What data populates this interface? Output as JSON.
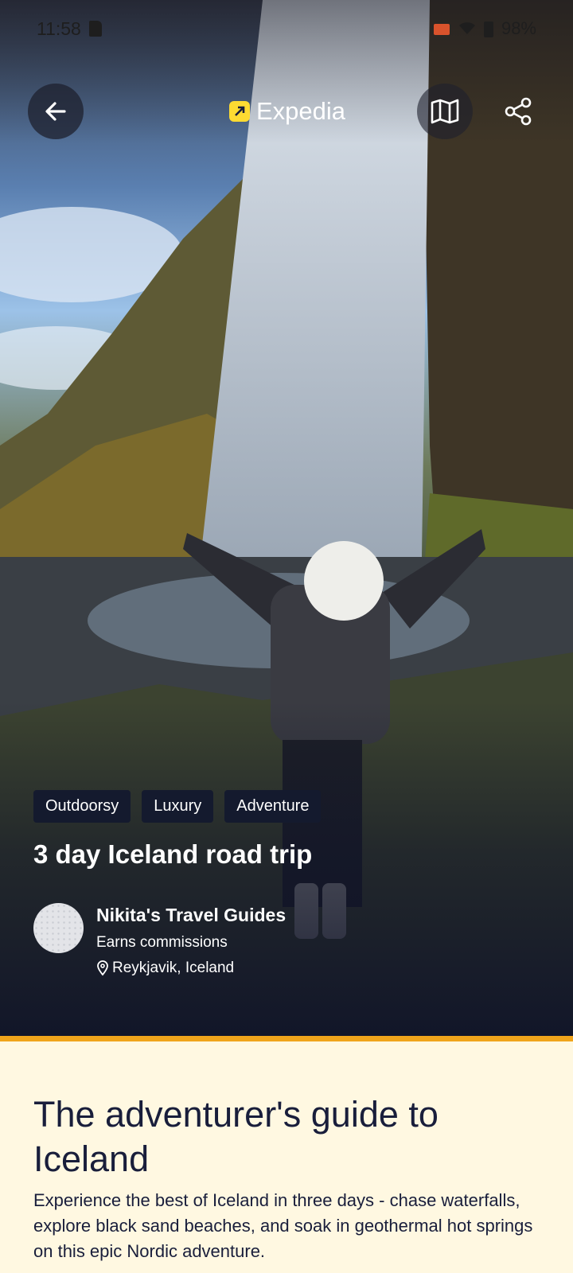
{
  "status_bar": {
    "time": "11:58",
    "battery": "98%"
  },
  "header": {
    "logo_text": "Expedia"
  },
  "trip": {
    "tags": [
      "Outdoorsy",
      "Luxury",
      "Adventure"
    ],
    "title": "3 day Iceland road trip",
    "author": {
      "name": "Nikita's Travel Guides",
      "note": "Earns commissions",
      "location": "Reykjavik, Iceland"
    }
  },
  "guide": {
    "title": "The adventurer's guide to Iceland",
    "description": "Experience the best of Iceland in three days - chase waterfalls, explore black sand beaches, and soak in geothermal hot springs on this epic Nordic adventure."
  },
  "colors": {
    "brand_yellow": "#fddb32",
    "accent_band": "#f0a41b",
    "tag_bg": "#141a2e",
    "text_dark": "#191e3b",
    "page_bg": "#fff8e1"
  },
  "icons": [
    "back-arrow-icon",
    "map-icon",
    "share-icon",
    "location-pin-icon",
    "expedia-logo-icon"
  ]
}
